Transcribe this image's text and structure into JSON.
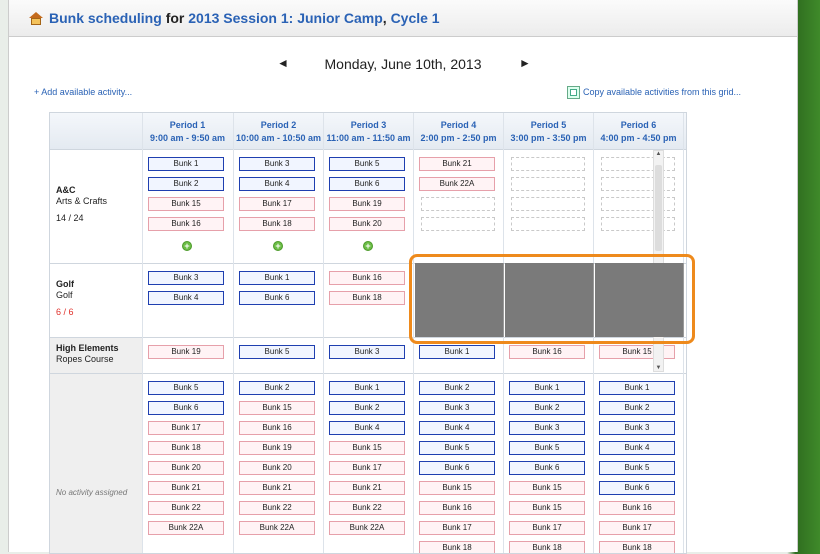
{
  "title": {
    "link1": "Bunk scheduling",
    "word_for": "for",
    "link2": "2013 Session 1: Junior Camp",
    "comma": ",",
    "link3": "Cycle 1"
  },
  "date_nav": {
    "prev": "◄",
    "date": "Monday, June 10th, 2013",
    "next": "►"
  },
  "links": {
    "add_activity": "+ Add available activity...",
    "copy_activities": "Copy available activities from this grid..."
  },
  "periods": [
    {
      "name": "Period 1",
      "time": "9:00 am - 9:50 am"
    },
    {
      "name": "Period 2",
      "time": "10:00 am - 10:50 am"
    },
    {
      "name": "Period 3",
      "time": "11:00 am - 11:50 am"
    },
    {
      "name": "Period 4",
      "time": "2:00 pm - 2:50 pm"
    },
    {
      "name": "Period 5",
      "time": "3:00 pm - 3:50 pm"
    },
    {
      "name": "Period 6",
      "time": "4:00 pm - 4:50 pm"
    }
  ],
  "activities": [
    {
      "code": "A&C",
      "name": "Arts & Crafts",
      "count": "14 / 24"
    },
    {
      "code": "Golf",
      "name": "Golf",
      "count": "6 / 6"
    },
    {
      "code": "High Elements",
      "name": "Ropes Course",
      "count": ""
    }
  ],
  "no_activity_label": "No activity assigned",
  "ac_bunks": [
    [
      "Bunk 1",
      "Bunk 2",
      "Bunk 15",
      "Bunk 16"
    ],
    [
      "Bunk 3",
      "Bunk 4",
      "Bunk 17",
      "Bunk 18"
    ],
    [
      "Bunk 5",
      "Bunk 6",
      "Bunk 19",
      "Bunk 20"
    ],
    [
      "Bunk 21",
      "Bunk 22A"
    ]
  ],
  "golf_bunks": [
    [
      "Bunk 3",
      "Bunk 4"
    ],
    [
      "Bunk 1",
      "Bunk 6"
    ],
    [
      "Bunk 16",
      "Bunk 18"
    ]
  ],
  "high_bunks": [
    "Bunk 19",
    "Bunk 5",
    "Bunk 3",
    "Bunk 1",
    "Bunk 16",
    "Bunk 15"
  ],
  "unassigned": [
    [
      "Bunk 5",
      "Bunk 6",
      "Bunk 17",
      "Bunk 18",
      "Bunk 20",
      "Bunk 21",
      "Bunk 22",
      "Bunk 22A"
    ],
    [
      "Bunk 2",
      "Bunk 15",
      "Bunk 16",
      "Bunk 19",
      "Bunk 20",
      "Bunk 21",
      "Bunk 22",
      "Bunk 22A"
    ],
    [
      "Bunk 1",
      "Bunk 2",
      "Bunk 4",
      "Bunk 15",
      "Bunk 17",
      "Bunk 21",
      "Bunk 22",
      "Bunk 22A"
    ],
    [
      "Bunk 2",
      "Bunk 3",
      "Bunk 4",
      "Bunk 5",
      "Bunk 6",
      "Bunk 15",
      "Bunk 16",
      "Bunk 17",
      "Bunk 18"
    ],
    [
      "Bunk 1",
      "Bunk 2",
      "Bunk 3",
      "Bunk 5",
      "Bunk 6",
      "Bunk 15",
      "Bunk 15",
      "Bunk 17",
      "Bunk 18"
    ],
    [
      "Bunk 1",
      "Bunk 2",
      "Bunk 3",
      "Bunk 4",
      "Bunk 5",
      "Bunk 6",
      "Bunk 16",
      "Bunk 17",
      "Bunk 18"
    ]
  ],
  "colors": {
    "link": "#2a62b5",
    "accent_highlight": "#ee8a1c",
    "bunk_border_blue": "#1f3fb0",
    "bunk_border_pink": "#e6a0aa"
  }
}
